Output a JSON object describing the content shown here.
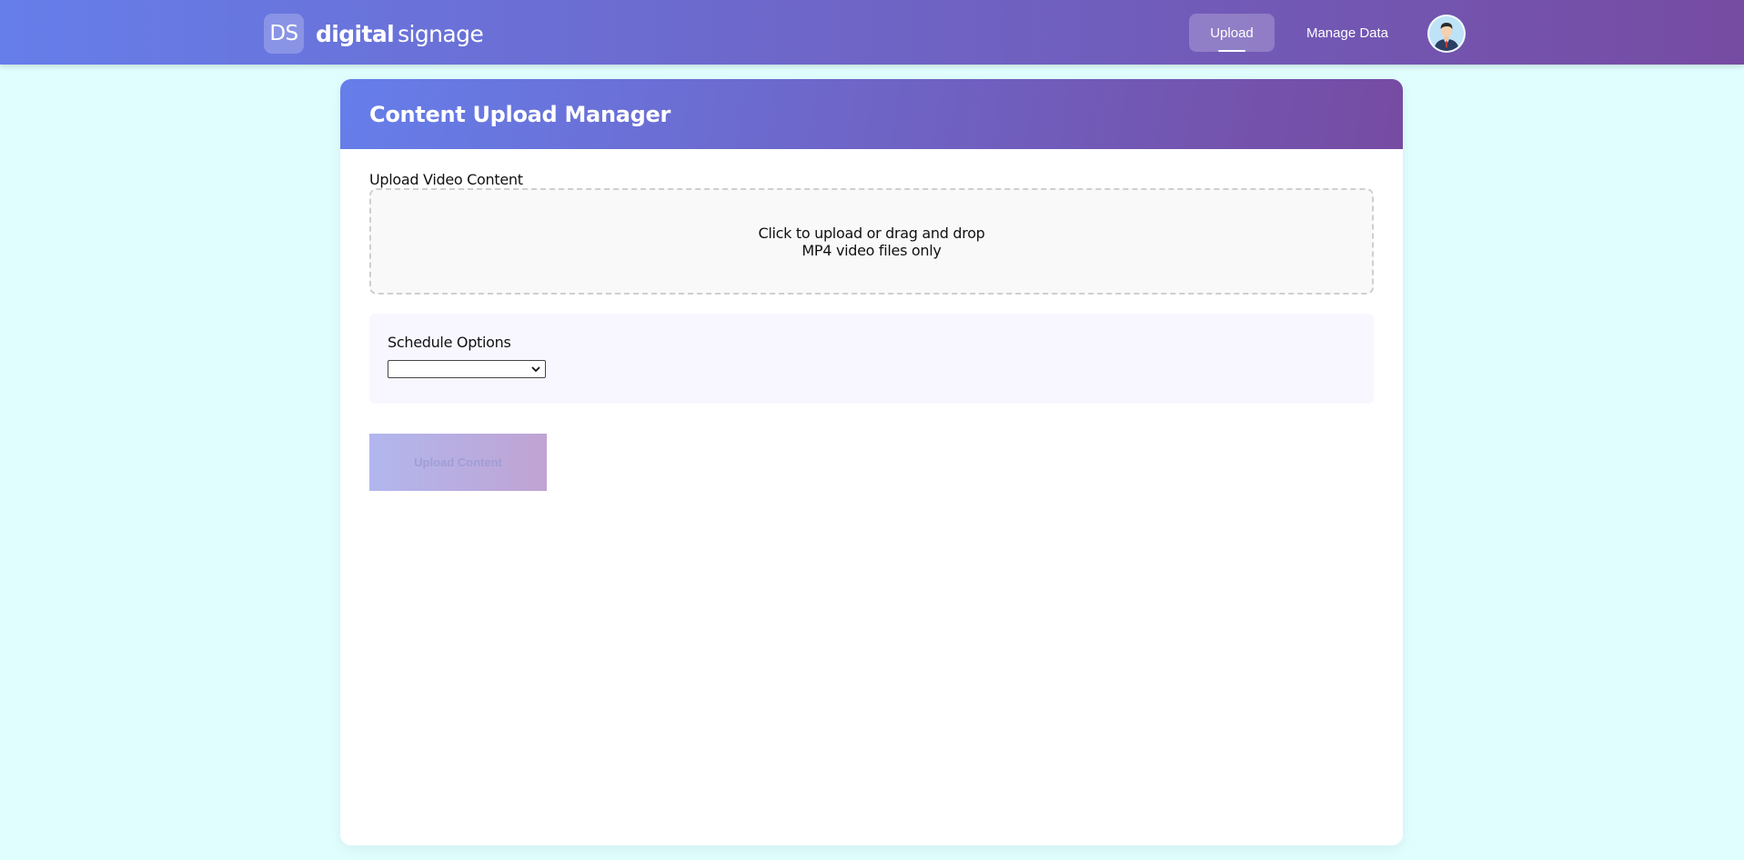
{
  "header": {
    "logo_badge": "DS",
    "brand_bold": "digital",
    "brand_light": "signage",
    "nav": [
      {
        "label": "Upload",
        "active": true
      },
      {
        "label": "Manage Data",
        "active": false
      }
    ],
    "avatar_icon": "user-avatar-icon",
    "gradient": [
      "#667eea",
      "#764ba2"
    ]
  },
  "page": {
    "background": "#e0fefe"
  },
  "card": {
    "title": "Content Upload Manager",
    "upload_label": "Upload Video Content",
    "dropzone": {
      "line1": "Click to upload or drag and drop",
      "line2": "MP4 video files only"
    },
    "schedule": {
      "label": "Schedule Options",
      "selected": ""
    },
    "submit_label": "Upload Content",
    "submit_enabled": false
  }
}
